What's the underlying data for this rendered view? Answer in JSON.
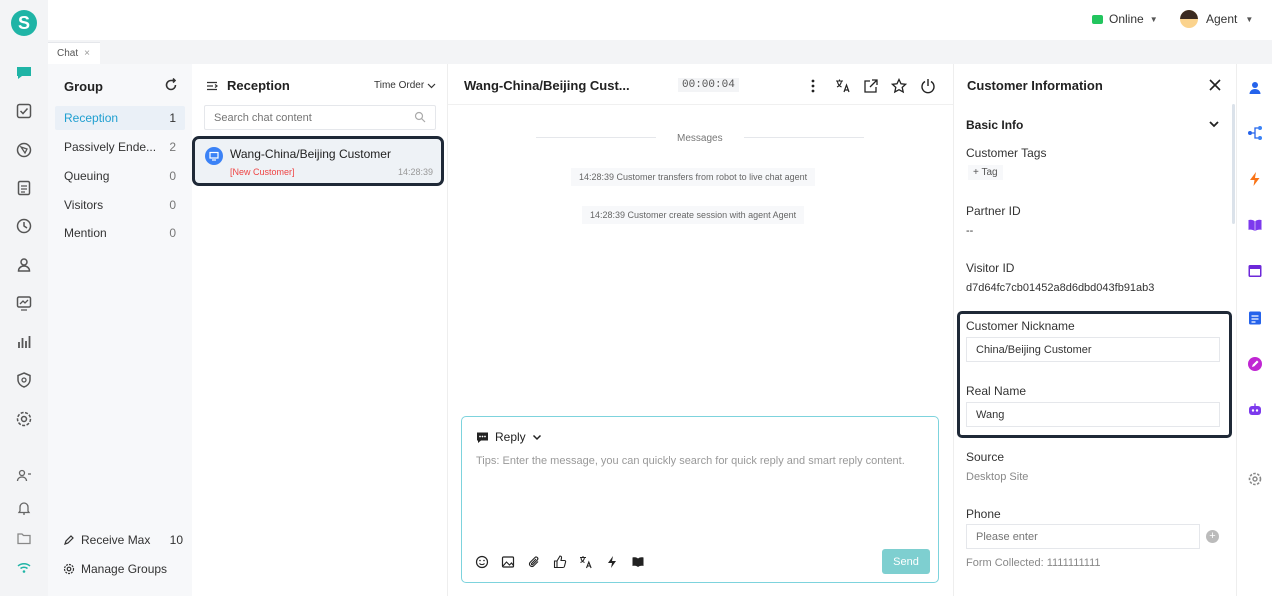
{
  "app": {
    "logo_letter": "S",
    "brand_color": "#1fb4a6"
  },
  "topbar": {
    "status": "Online",
    "agent": "Agent"
  },
  "tabs": [
    {
      "label": "Chat",
      "close": "×"
    }
  ],
  "group": {
    "title": "Group",
    "items": [
      {
        "label": "Reception",
        "count": "1"
      },
      {
        "label": "Passively Ende...",
        "count": "2"
      },
      {
        "label": "Queuing",
        "count": "0"
      },
      {
        "label": "Visitors",
        "count": "0"
      },
      {
        "label": "Mention",
        "count": "0"
      }
    ],
    "receive_max_label": "Receive Max",
    "receive_max_value": "10",
    "manage_groups": "Manage Groups"
  },
  "reception": {
    "title": "Reception",
    "sort": "Time Order",
    "search_placeholder": "Search chat content",
    "conversation": {
      "name": "Wang-China/Beijing Customer",
      "tag": "[New Customer]",
      "time": "14:28:39"
    }
  },
  "chat": {
    "title": "Wang-China/Beijing Cust...",
    "timer": "00:00:04",
    "messages_label": "Messages",
    "system_messages": [
      "14:28:39 Customer transfers from robot to live chat agent",
      "14:28:39 Customer create session with agent Agent"
    ],
    "reply_mode": "Reply",
    "input_placeholder": "Tips: Enter the message, you can quickly search for quick reply and smart reply content.",
    "send": "Send"
  },
  "info": {
    "title": "Customer Information",
    "section": "Basic Info",
    "customer_tags_label": "Customer Tags",
    "tag_button": "+ Tag",
    "partner_id_label": "Partner ID",
    "partner_id": "--",
    "visitor_id_label": "Visitor ID",
    "visitor_id": "d7d64fc7cb01452a8d6dbd043fb91ab3",
    "nickname_label": "Customer Nickname",
    "nickname": "China/Beijing Customer",
    "real_name_label": "Real Name",
    "real_name": "Wang",
    "source_label": "Source",
    "source": "Desktop Site",
    "phone_label": "Phone",
    "phone_placeholder": "Please enter",
    "form_collected": "Form Collected: 1111111111"
  }
}
